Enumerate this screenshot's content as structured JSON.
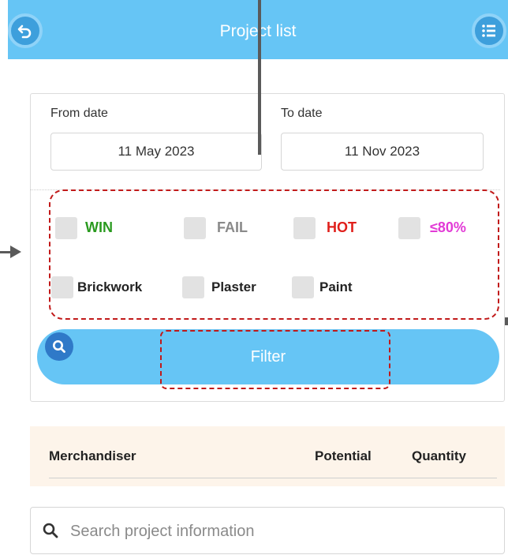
{
  "header": {
    "title": "Project list",
    "back_icon": "back-arrow-icon",
    "menu_icon": "list-menu-icon",
    "color": "#66c5f5"
  },
  "dates": {
    "from_label": "From date",
    "from_value": "11 May 2023",
    "to_label": "To date",
    "to_value": "11 Nov 2023"
  },
  "statuses": [
    {
      "label": "WIN",
      "color": "#2a9a1f",
      "checked": false
    },
    {
      "label": "FAIL",
      "color": "#8a8a8a",
      "checked": false
    },
    {
      "label": "HOT",
      "color": "#e0201c",
      "checked": false
    },
    {
      "label": "≤80%",
      "color": "#e23ad6",
      "checked": false
    }
  ],
  "categories": [
    {
      "label": "Brickwork",
      "checked": false
    },
    {
      "label": "Plaster",
      "checked": false
    },
    {
      "label": "Paint",
      "checked": false
    }
  ],
  "filter": {
    "label": "Filter",
    "icon": "search-icon"
  },
  "table": {
    "col_merchandiser": "Merchandiser",
    "col_potential": "Potential",
    "col_quantity": "Quantity"
  },
  "search": {
    "placeholder": "Search project information",
    "value": ""
  },
  "colors": {
    "annotation_red": "#c11a1a",
    "accent_blue": "#66c5f5",
    "table_head_bg": "#fdf4ea"
  }
}
